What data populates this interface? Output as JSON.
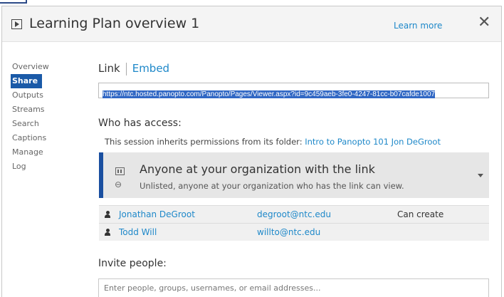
{
  "dialog": {
    "title": "Learning Plan overview 1",
    "learn_more": "Learn more",
    "close_glyph": "✕"
  },
  "sidebar": {
    "items": [
      {
        "label": "Overview",
        "active": false
      },
      {
        "label": "Share",
        "active": true
      },
      {
        "label": "Outputs",
        "active": false
      },
      {
        "label": "Streams",
        "active": false
      },
      {
        "label": "Search",
        "active": false
      },
      {
        "label": "Captions",
        "active": false
      },
      {
        "label": "Manage",
        "active": false
      },
      {
        "label": "Log",
        "active": false
      }
    ]
  },
  "share": {
    "tab_link": "Link",
    "tab_embed": "Embed",
    "url": "https://ntc.hosted.panopto.com/Panopto/Pages/Viewer.aspx?id=9c459aeb-3fe0-4247-81cc-b07cafde1007",
    "who_title": "Who has access:",
    "inherit_text": "This session inherits permissions from its folder: ",
    "inherit_folder": "Intro to Panopto 101 Jon DeGroot",
    "access_title": "Anyone at your organization with the link",
    "access_subtitle": "Unlisted, anyone at your organization who has the link can view.",
    "users": [
      {
        "name": "Jonathan DeGroot",
        "email": "degroot@ntc.edu",
        "permission": "Can create"
      },
      {
        "name": "Todd Will",
        "email": "willto@ntc.edu",
        "permission": ""
      }
    ],
    "invite_title": "Invite people:",
    "invite_placeholder": "Enter people, groups, usernames, or email addresses..."
  },
  "colors": {
    "accent": "#1e88c9",
    "active_nav": "#1a5aa8",
    "access_bar": "#1a4fa0"
  }
}
